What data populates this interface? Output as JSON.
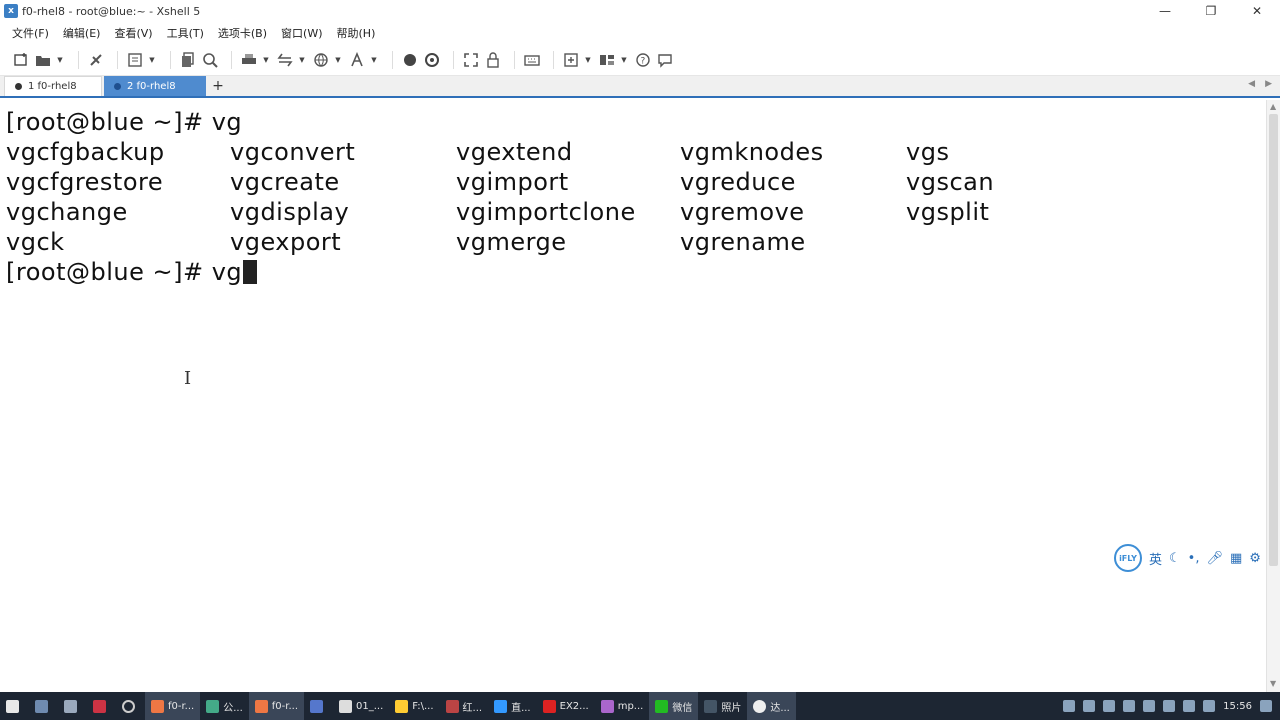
{
  "window": {
    "title": "f0-rhel8 - root@blue:~ - Xshell 5",
    "controls": [
      "—",
      "❐",
      "✕"
    ]
  },
  "menu": [
    "文件(F)",
    "编辑(E)",
    "查看(V)",
    "工具(T)",
    "选项卡(B)",
    "窗口(W)",
    "帮助(H)"
  ],
  "tabs": [
    {
      "label": "1 f0-rhel8",
      "active": false
    },
    {
      "label": "2 f0-rhel8",
      "active": true
    }
  ],
  "tab_add": "+",
  "terminal": {
    "prompt_line_1": "[root@blue ~]# vg",
    "rows": [
      [
        "vgcfgbackup",
        "vgconvert",
        "vgextend",
        "vgmknodes",
        "vgs"
      ],
      [
        "vgcfgrestore",
        "vgcreate",
        "vgimport",
        "vgreduce",
        "vgscan"
      ],
      [
        "vgchange",
        "vgdisplay",
        "vgimportclone",
        "vgremove",
        "vgsplit"
      ],
      [
        "vgck",
        "vgexport",
        "vgmerge",
        "vgrename",
        ""
      ]
    ],
    "prompt_line_2": "[root@blue ~]# vg"
  },
  "ime": {
    "logo": "iFLY",
    "mode": "英"
  },
  "taskbar": {
    "items": [
      "f0-r...",
      "公...",
      "f0-r...",
      "01_...",
      "F:\\...",
      "红...",
      "直...",
      "EX2...",
      "mp...",
      "微信",
      "照片",
      "达..."
    ],
    "clock": "15:56"
  }
}
